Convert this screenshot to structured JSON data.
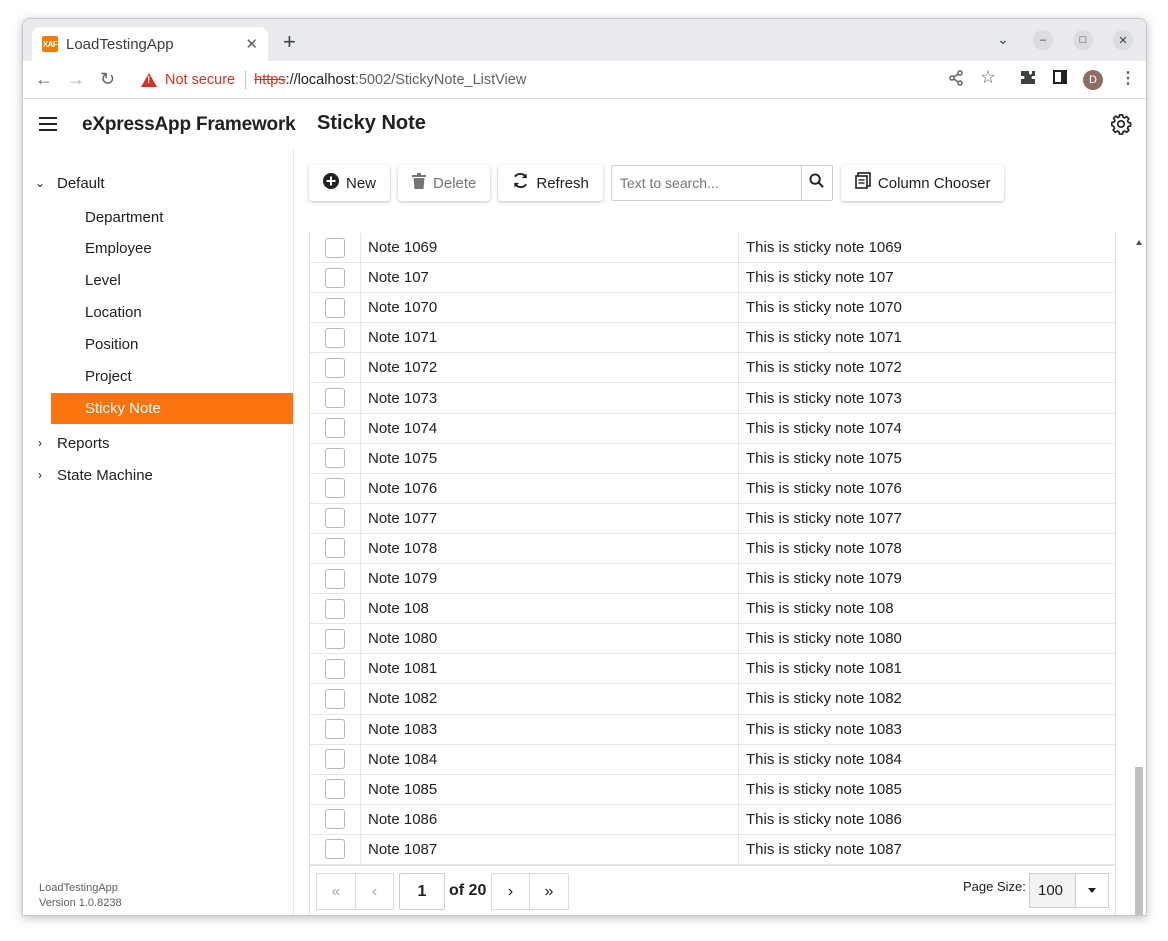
{
  "browser": {
    "tab_title": "LoadTestingApp",
    "favicon_text": "XAF",
    "security_label": "Not secure",
    "url_scheme": "https",
    "url_host": "://localhost",
    "url_path": ":5002/StickyNote_ListView",
    "profile_initial": "D"
  },
  "header": {
    "brand": "eXpressApp Framework",
    "page_title": "Sticky Note"
  },
  "sidebar": {
    "groups": [
      {
        "label": "Default",
        "expanded": true
      },
      {
        "label": "Reports",
        "expanded": false
      },
      {
        "label": "State Machine",
        "expanded": false
      }
    ],
    "items": [
      {
        "label": "Department"
      },
      {
        "label": "Employee"
      },
      {
        "label": "Level"
      },
      {
        "label": "Location"
      },
      {
        "label": "Position"
      },
      {
        "label": "Project"
      },
      {
        "label": "Sticky Note",
        "active": true
      }
    ],
    "footer_app": "LoadTestingApp",
    "footer_version": "Version 1.0.8238"
  },
  "toolbar": {
    "new_label": "New",
    "delete_label": "Delete",
    "refresh_label": "Refresh",
    "search_placeholder": "Text to search...",
    "column_chooser_label": "Column Chooser"
  },
  "grid": {
    "rows": [
      [
        "Note 1069",
        "This is sticky note 1069"
      ],
      [
        "Note 107",
        "This is sticky note 107"
      ],
      [
        "Note 1070",
        "This is sticky note 1070"
      ],
      [
        "Note 1071",
        "This is sticky note 1071"
      ],
      [
        "Note 1072",
        "This is sticky note 1072"
      ],
      [
        "Note 1073",
        "This is sticky note 1073"
      ],
      [
        "Note 1074",
        "This is sticky note 1074"
      ],
      [
        "Note 1075",
        "This is sticky note 1075"
      ],
      [
        "Note 1076",
        "This is sticky note 1076"
      ],
      [
        "Note 1077",
        "This is sticky note 1077"
      ],
      [
        "Note 1078",
        "This is sticky note 1078"
      ],
      [
        "Note 1079",
        "This is sticky note 1079"
      ],
      [
        "Note 108",
        "This is sticky note 108"
      ],
      [
        "Note 1080",
        "This is sticky note 1080"
      ],
      [
        "Note 1081",
        "This is sticky note 1081"
      ],
      [
        "Note 1082",
        "This is sticky note 1082"
      ],
      [
        "Note 1083",
        "This is sticky note 1083"
      ],
      [
        "Note 1084",
        "This is sticky note 1084"
      ],
      [
        "Note 1085",
        "This is sticky note 1085"
      ],
      [
        "Note 1086",
        "This is sticky note 1086"
      ],
      [
        "Note 1087",
        "This is sticky note 1087"
      ]
    ]
  },
  "pager": {
    "current_page": "1",
    "of_pages": "of 20",
    "page_size_label": "Page Size:",
    "page_size": "100"
  },
  "colors": {
    "accent": "#fb7410",
    "not_secure": "#d93025"
  }
}
